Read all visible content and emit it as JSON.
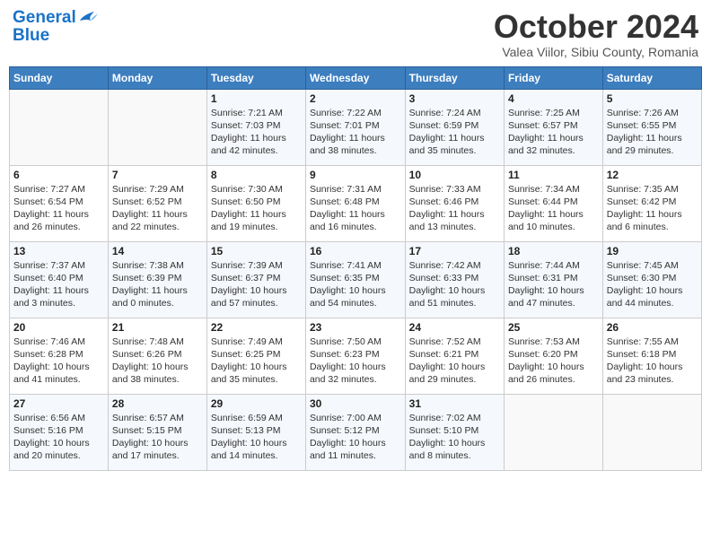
{
  "header": {
    "logo_line1": "General",
    "logo_line2": "Blue",
    "month": "October 2024",
    "location": "Valea Viilor, Sibiu County, Romania"
  },
  "days_of_week": [
    "Sunday",
    "Monday",
    "Tuesday",
    "Wednesday",
    "Thursday",
    "Friday",
    "Saturday"
  ],
  "weeks": [
    [
      {
        "day": "",
        "info": ""
      },
      {
        "day": "",
        "info": ""
      },
      {
        "day": "1",
        "info": "Sunrise: 7:21 AM\nSunset: 7:03 PM\nDaylight: 11 hours and 42 minutes."
      },
      {
        "day": "2",
        "info": "Sunrise: 7:22 AM\nSunset: 7:01 PM\nDaylight: 11 hours and 38 minutes."
      },
      {
        "day": "3",
        "info": "Sunrise: 7:24 AM\nSunset: 6:59 PM\nDaylight: 11 hours and 35 minutes."
      },
      {
        "day": "4",
        "info": "Sunrise: 7:25 AM\nSunset: 6:57 PM\nDaylight: 11 hours and 32 minutes."
      },
      {
        "day": "5",
        "info": "Sunrise: 7:26 AM\nSunset: 6:55 PM\nDaylight: 11 hours and 29 minutes."
      }
    ],
    [
      {
        "day": "6",
        "info": "Sunrise: 7:27 AM\nSunset: 6:54 PM\nDaylight: 11 hours and 26 minutes."
      },
      {
        "day": "7",
        "info": "Sunrise: 7:29 AM\nSunset: 6:52 PM\nDaylight: 11 hours and 22 minutes."
      },
      {
        "day": "8",
        "info": "Sunrise: 7:30 AM\nSunset: 6:50 PM\nDaylight: 11 hours and 19 minutes."
      },
      {
        "day": "9",
        "info": "Sunrise: 7:31 AM\nSunset: 6:48 PM\nDaylight: 11 hours and 16 minutes."
      },
      {
        "day": "10",
        "info": "Sunrise: 7:33 AM\nSunset: 6:46 PM\nDaylight: 11 hours and 13 minutes."
      },
      {
        "day": "11",
        "info": "Sunrise: 7:34 AM\nSunset: 6:44 PM\nDaylight: 11 hours and 10 minutes."
      },
      {
        "day": "12",
        "info": "Sunrise: 7:35 AM\nSunset: 6:42 PM\nDaylight: 11 hours and 6 minutes."
      }
    ],
    [
      {
        "day": "13",
        "info": "Sunrise: 7:37 AM\nSunset: 6:40 PM\nDaylight: 11 hours and 3 minutes."
      },
      {
        "day": "14",
        "info": "Sunrise: 7:38 AM\nSunset: 6:39 PM\nDaylight: 11 hours and 0 minutes."
      },
      {
        "day": "15",
        "info": "Sunrise: 7:39 AM\nSunset: 6:37 PM\nDaylight: 10 hours and 57 minutes."
      },
      {
        "day": "16",
        "info": "Sunrise: 7:41 AM\nSunset: 6:35 PM\nDaylight: 10 hours and 54 minutes."
      },
      {
        "day": "17",
        "info": "Sunrise: 7:42 AM\nSunset: 6:33 PM\nDaylight: 10 hours and 51 minutes."
      },
      {
        "day": "18",
        "info": "Sunrise: 7:44 AM\nSunset: 6:31 PM\nDaylight: 10 hours and 47 minutes."
      },
      {
        "day": "19",
        "info": "Sunrise: 7:45 AM\nSunset: 6:30 PM\nDaylight: 10 hours and 44 minutes."
      }
    ],
    [
      {
        "day": "20",
        "info": "Sunrise: 7:46 AM\nSunset: 6:28 PM\nDaylight: 10 hours and 41 minutes."
      },
      {
        "day": "21",
        "info": "Sunrise: 7:48 AM\nSunset: 6:26 PM\nDaylight: 10 hours and 38 minutes."
      },
      {
        "day": "22",
        "info": "Sunrise: 7:49 AM\nSunset: 6:25 PM\nDaylight: 10 hours and 35 minutes."
      },
      {
        "day": "23",
        "info": "Sunrise: 7:50 AM\nSunset: 6:23 PM\nDaylight: 10 hours and 32 minutes."
      },
      {
        "day": "24",
        "info": "Sunrise: 7:52 AM\nSunset: 6:21 PM\nDaylight: 10 hours and 29 minutes."
      },
      {
        "day": "25",
        "info": "Sunrise: 7:53 AM\nSunset: 6:20 PM\nDaylight: 10 hours and 26 minutes."
      },
      {
        "day": "26",
        "info": "Sunrise: 7:55 AM\nSunset: 6:18 PM\nDaylight: 10 hours and 23 minutes."
      }
    ],
    [
      {
        "day": "27",
        "info": "Sunrise: 6:56 AM\nSunset: 5:16 PM\nDaylight: 10 hours and 20 minutes."
      },
      {
        "day": "28",
        "info": "Sunrise: 6:57 AM\nSunset: 5:15 PM\nDaylight: 10 hours and 17 minutes."
      },
      {
        "day": "29",
        "info": "Sunrise: 6:59 AM\nSunset: 5:13 PM\nDaylight: 10 hours and 14 minutes."
      },
      {
        "day": "30",
        "info": "Sunrise: 7:00 AM\nSunset: 5:12 PM\nDaylight: 10 hours and 11 minutes."
      },
      {
        "day": "31",
        "info": "Sunrise: 7:02 AM\nSunset: 5:10 PM\nDaylight: 10 hours and 8 minutes."
      },
      {
        "day": "",
        "info": ""
      },
      {
        "day": "",
        "info": ""
      }
    ]
  ]
}
